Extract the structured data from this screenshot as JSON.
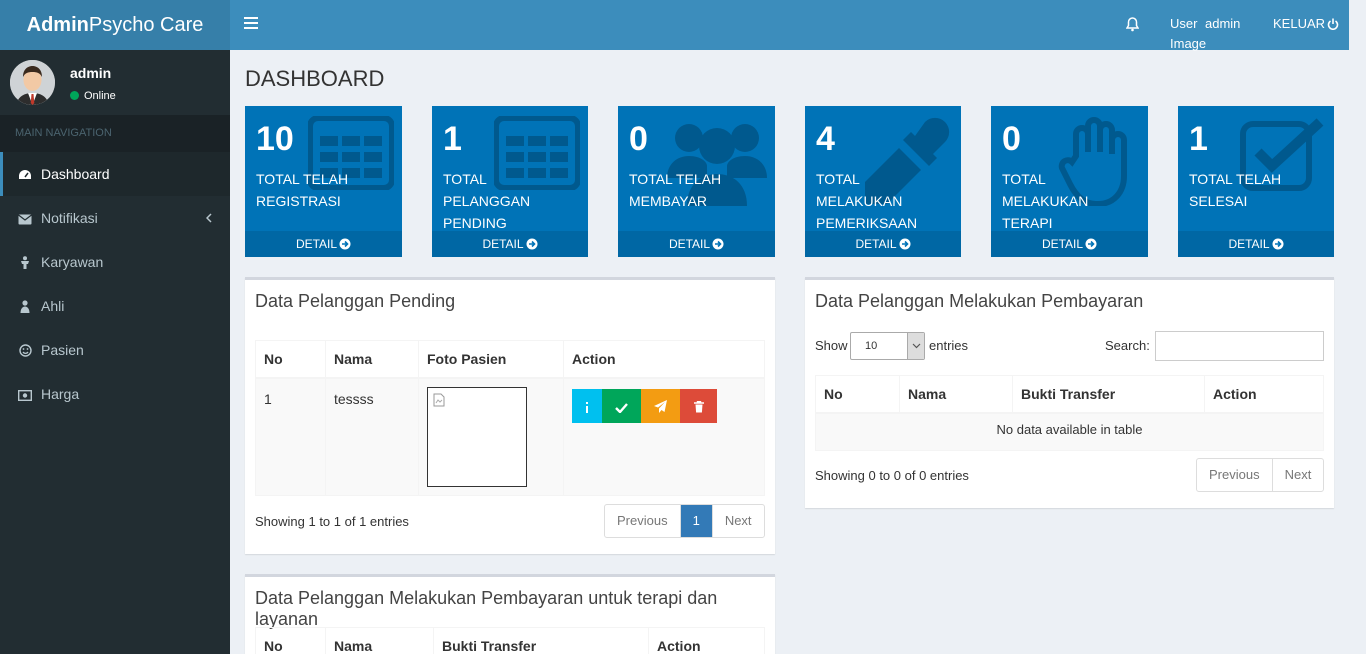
{
  "brand": {
    "bold": "Admin",
    "rest": "Psycho Care"
  },
  "navbar": {
    "user_image_alt": "User Image",
    "user_name": "admin",
    "logout": "KELUAR"
  },
  "sidebar": {
    "user": {
      "name": "admin",
      "status": "Online"
    },
    "header": "MAIN NAVIGATION",
    "items": [
      {
        "label": "Dashboard",
        "icon": "dashboard-icon"
      },
      {
        "label": "Notifikasi",
        "icon": "envelope-icon"
      },
      {
        "label": "Karyawan",
        "icon": "user-icon"
      },
      {
        "label": "Ahli",
        "icon": "user-doctor-icon"
      },
      {
        "label": "Pasien",
        "icon": "smile-icon"
      },
      {
        "label": "Harga",
        "icon": "money-icon"
      }
    ]
  },
  "page": {
    "title": "DASHBOARD"
  },
  "stats": [
    {
      "value": "10",
      "label": "TOTAL TELAH REGISTRASI",
      "link": "DETAIL",
      "icon": "grid-icon"
    },
    {
      "value": "1",
      "label": "TOTAL PELANGGAN PENDING",
      "link": "DETAIL",
      "icon": "grid-icon"
    },
    {
      "value": "0",
      "label": "TOTAL TELAH MEMBAYAR",
      "link": "DETAIL",
      "icon": "users-icon"
    },
    {
      "value": "4",
      "label": "TOTAL MELAKUKAN PEMERIKSAAN",
      "link": "DETAIL",
      "icon": "eyedropper-icon"
    },
    {
      "value": "0",
      "label": "TOTAL MELAKUKAN TERAPI",
      "link": "DETAIL",
      "icon": "hand-icon"
    },
    {
      "value": "1",
      "label": "TOTAL TELAH SELESAI",
      "link": "DETAIL",
      "icon": "check-square-icon"
    }
  ],
  "pending": {
    "title": "Data Pelanggan Pending",
    "columns": [
      "No",
      "Nama",
      "Foto Pasien",
      "Action"
    ],
    "rows": [
      {
        "no": "1",
        "nama": "tessss"
      }
    ],
    "info": "Showing 1 to 1 of 1 entries",
    "pager": {
      "prev": "Previous",
      "page": "1",
      "next": "Next"
    }
  },
  "payment": {
    "title": "Data Pelanggan Melakukan Pembayaran",
    "show": "Show",
    "length": "10",
    "entries": "entries",
    "search_label": "Search:",
    "columns": [
      "No",
      "Nama",
      "Bukti Transfer",
      "Action"
    ],
    "empty": "No data available in table",
    "info": "Showing 0 to 0 of 0 entries",
    "pager": {
      "prev": "Previous",
      "next": "Next"
    }
  },
  "therapy": {
    "title": "Data Pelanggan Melakukan Pembayaran untuk terapi dan layanan",
    "columns": [
      "No",
      "Nama",
      "Bukti Transfer",
      "Action"
    ]
  },
  "colors": {
    "primary": "#0073b7",
    "header": "#3c8dbc",
    "sidebar": "#222d32",
    "info": "#00c0ef",
    "success": "#00a65a",
    "warning": "#f39c12",
    "danger": "#dd4b39"
  }
}
